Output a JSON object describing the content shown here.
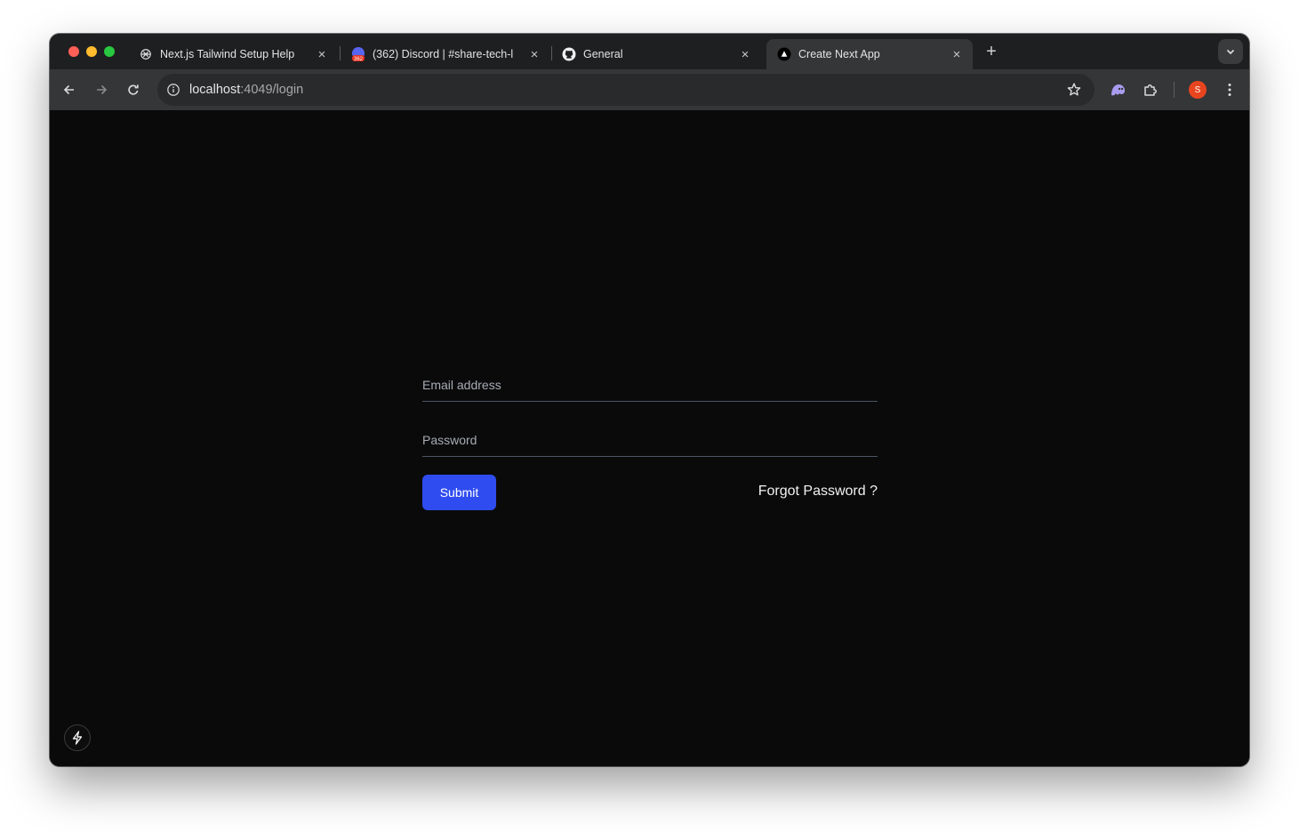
{
  "browser": {
    "tabs": [
      {
        "title": "Next.js Tailwind Setup Help",
        "favicon": "openai-icon",
        "active": false
      },
      {
        "title": "(362) Discord | #share-tech-l",
        "favicon": "discord-icon",
        "badge": "362",
        "active": false
      },
      {
        "title": "General",
        "favicon": "github-icon",
        "active": false
      },
      {
        "title": "Create Next App",
        "favicon": "vercel-icon",
        "active": true
      }
    ],
    "url_host": "localhost",
    "url_path": ":4049/login",
    "profile_initial": "S"
  },
  "login": {
    "email_placeholder": "Email address",
    "password_placeholder": "Password",
    "submit_label": "Submit",
    "forgot_label": "Forgot Password ?"
  },
  "colors": {
    "page_bg": "#0a0a0b",
    "accent": "#2f4cf0"
  }
}
